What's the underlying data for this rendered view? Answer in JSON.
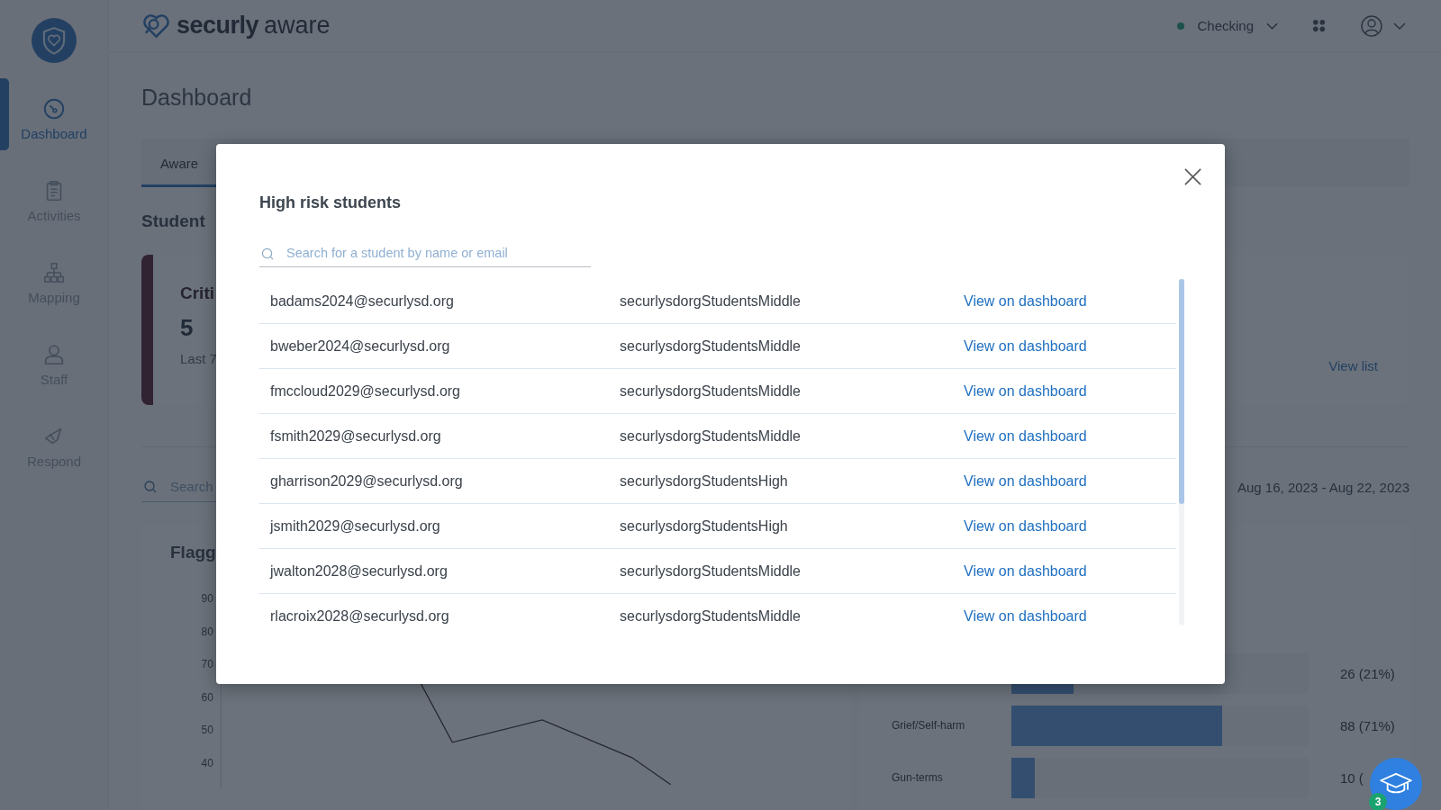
{
  "sidebar": {
    "items": [
      {
        "label": "Dashboard",
        "selected": true
      },
      {
        "label": "Activities",
        "selected": false
      },
      {
        "label": "Mapping",
        "selected": false
      },
      {
        "label": "Staff",
        "selected": false
      },
      {
        "label": "Respond",
        "selected": false
      }
    ]
  },
  "header": {
    "brand_bold": "securly",
    "brand_light": "aware",
    "status": "Checking"
  },
  "page_title": "Dashboard",
  "tabs": [
    {
      "label": "Aware",
      "selected": true
    }
  ],
  "section_title": "Student",
  "summary_card": {
    "title": "Criti",
    "count": "5",
    "caption": "Last 7",
    "link": "View list"
  },
  "search": {
    "placeholder": "Search"
  },
  "date_range": "Aug 16, 2023 - Aug 22, 2023",
  "flagged_card": {
    "title": "Flagg",
    "y_ticks": [
      "90",
      "80",
      "70",
      "60",
      "50",
      "40"
    ]
  },
  "category_bars": [
    {
      "value": "26 (21%)",
      "level": 0.21
    },
    {
      "label": "Grief/Self-harm",
      "value": "88 (71%)",
      "level": 0.71
    },
    {
      "label": "Gun-terms",
      "value": "10 (",
      "level": 0.08
    }
  ],
  "modal": {
    "title": "High risk students",
    "search": {
      "placeholder": "Search for a student by name or email"
    },
    "students": [
      {
        "email": "badams2024@securlysd.org",
        "group": "securlysdorgStudentsMiddle",
        "link": "View on dashboard"
      },
      {
        "email": "bweber2024@securlysd.org",
        "group": "securlysdorgStudentsMiddle",
        "link": "View on dashboard"
      },
      {
        "email": "fmccloud2029@securlysd.org",
        "group": "securlysdorgStudentsMiddle",
        "link": "View on dashboard"
      },
      {
        "email": "fsmith2029@securlysd.org",
        "group": "securlysdorgStudentsMiddle",
        "link": "View on dashboard"
      },
      {
        "email": "gharrison2029@securlysd.org",
        "group": "securlysdorgStudentsHigh",
        "link": "View on dashboard"
      },
      {
        "email": "jsmith2029@securlysd.org",
        "group": "securlysdorgStudentsHigh",
        "link": "View on dashboard"
      },
      {
        "email": "jwalton2028@securlysd.org",
        "group": "securlysdorgStudentsMiddle",
        "link": "View on dashboard"
      },
      {
        "email": "rlacroix2028@securlysd.org",
        "group": "securlysdorgStudentsMiddle",
        "link": "View on dashboard"
      }
    ]
  },
  "help": {
    "badge": "3"
  }
}
